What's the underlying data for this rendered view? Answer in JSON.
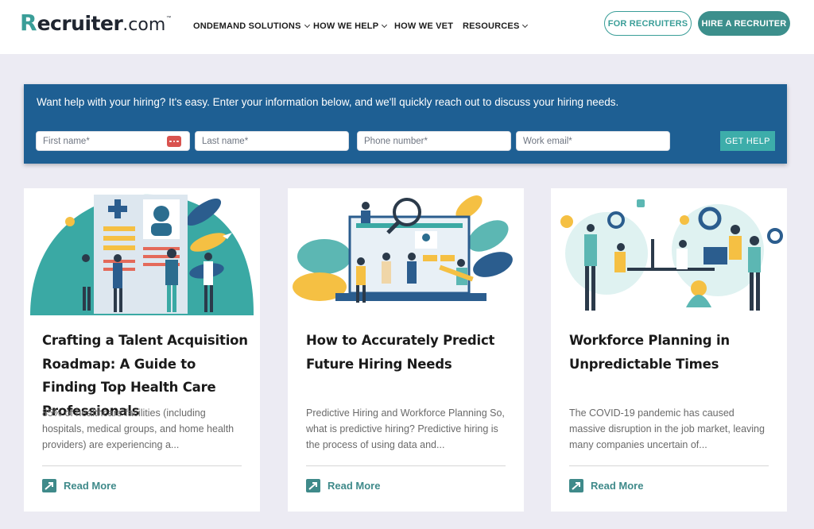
{
  "header": {
    "logo": {
      "first_letter": "R",
      "main": "ecruiter",
      "suffix": ".com",
      "tm": "™"
    },
    "nav": [
      {
        "label": "ONDEMAND SOLUTIONS",
        "has_dropdown": true
      },
      {
        "label": "HOW WE HELP",
        "has_dropdown": true
      },
      {
        "label": "HOW WE VET",
        "has_dropdown": false
      },
      {
        "label": "RESOURCES",
        "has_dropdown": true
      }
    ],
    "for_recruiters_label": "FOR RECRUITERS",
    "hire_recruiter_label": "HIRE A RECRUITER"
  },
  "form": {
    "prompt": "Want help with your hiring? It's easy. Enter your information below, and we'll quickly reach out to discuss your hiring needs.",
    "fields": [
      {
        "placeholder": "First name*"
      },
      {
        "placeholder": "Last name*"
      },
      {
        "placeholder": "Phone number*"
      },
      {
        "placeholder": "Work email*"
      }
    ],
    "submit_label": "GET HELP"
  },
  "cards": [
    {
      "title": "Crafting a Talent Acquisition Roadmap: A Guide to Finding Top Health Care Professionals",
      "excerpt": "85% of healthcare facilities (including hospitals, medical groups, and home health providers) are experiencing a...",
      "read_more": "Read More",
      "illustration": "healthcare-recruitment-illustration"
    },
    {
      "title": "How to Accurately Predict Future Hiring Needs",
      "excerpt": "Predictive Hiring and Workforce Planning So, what is predictive hiring? Predictive hiring is the process of using data and...",
      "read_more": "Read More",
      "illustration": "predictive-hiring-illustration"
    },
    {
      "title": "Workforce Planning in Unpredictable Times",
      "excerpt": "The COVID-19 pandemic has caused massive disruption in the job market, leaving many companies uncertain of...",
      "read_more": "Read More",
      "illustration": "workforce-planning-illustration"
    }
  ],
  "colors": {
    "brand_teal": "#3a9e98",
    "banner_blue": "#1e5f93",
    "button_teal": "#3dadaa",
    "read_more_teal": "#3f8a8a",
    "page_bg": "#ecebf3"
  }
}
